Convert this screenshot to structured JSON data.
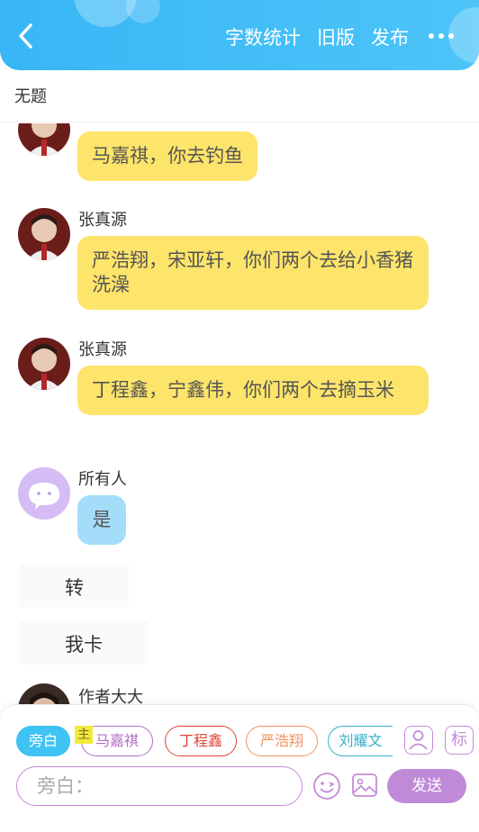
{
  "header": {
    "word_count": "字数统计",
    "old_version": "旧版",
    "publish": "发布"
  },
  "title": "无题",
  "messages": [
    {
      "sender": "",
      "text": "马嘉祺，你去钓鱼",
      "bubble_color": "#fde46a"
    },
    {
      "sender": "张真源",
      "text": "严浩翔，宋亚轩，你们两个去给小香猪洗澡",
      "bubble_color": "#fde46a"
    },
    {
      "sender": "张真源",
      "text": "丁程鑫，宁鑫伟，你们两个去摘玉米",
      "bubble_color": "#fde46a"
    },
    {
      "sender": "所有人",
      "text": "是",
      "bubble_color": "#a3ddfa"
    },
    {
      "sender": "",
      "text": "转"
    },
    {
      "sender": "",
      "text": "我卡"
    },
    {
      "sender": "作者大大",
      "text": ""
    }
  ],
  "panel": {
    "roles": [
      "旁白",
      "马嘉祺",
      "丁程鑫",
      "严浩翔",
      "刘耀文"
    ],
    "main_tag": "主",
    "tag_button": "标",
    "input_placeholder": "旁白：",
    "send": "发送"
  },
  "colors": {
    "header": "#3ab9f6",
    "accent_purple": "#c08ad8",
    "yellow_bubble": "#fde46a",
    "blue_bubble": "#a3ddfa"
  },
  "icons": [
    "back-arrow-icon",
    "more-dots-icon",
    "person-card-icon",
    "emoji-icon",
    "image-icon"
  ]
}
